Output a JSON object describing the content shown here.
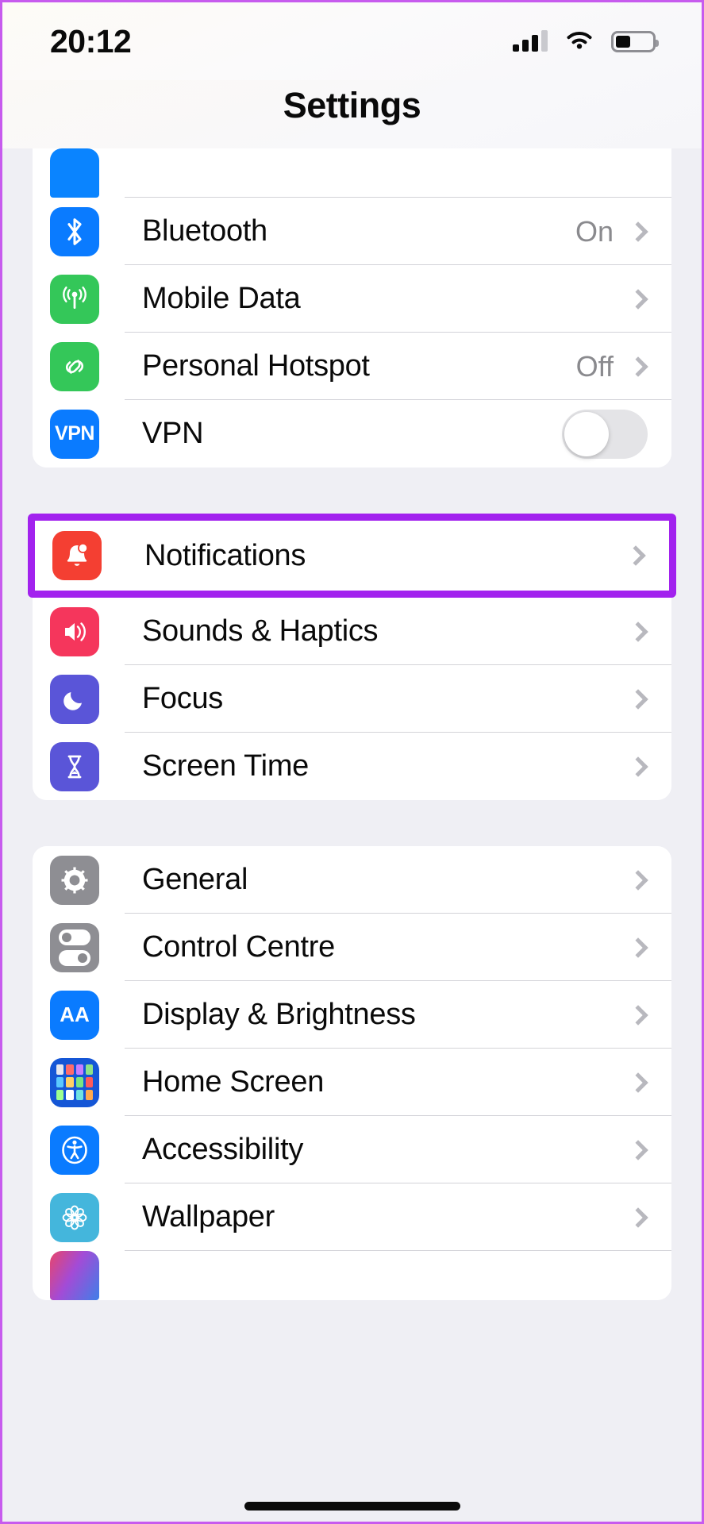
{
  "status_bar": {
    "time": "20:12",
    "signal_icon": "cellular-signal-icon",
    "wifi_icon": "wifi-icon",
    "battery_icon": "battery-icon",
    "battery_level_percent": 42
  },
  "nav": {
    "title": "Settings"
  },
  "highlight_color": "#A222EE",
  "frame_border_color": "#C75BEE",
  "groups": [
    {
      "name": "connectivity",
      "clipped_top": true,
      "rows": [
        {
          "label": "",
          "icon": "wifi-settings-icon",
          "icon_color": "#0A84FF",
          "value": "",
          "accessory": "none",
          "cut": true
        },
        {
          "label": "Bluetooth",
          "icon": "bluetooth-icon",
          "icon_color": "#0A7BFF",
          "value": "On",
          "accessory": "chevron"
        },
        {
          "label": "Mobile Data",
          "icon": "mobile-data-icon",
          "icon_color": "#34C759",
          "value": "",
          "accessory": "chevron"
        },
        {
          "label": "Personal Hotspot",
          "icon": "personal-hotspot-icon",
          "icon_color": "#34C759",
          "value": "Off",
          "accessory": "chevron"
        },
        {
          "label": "VPN",
          "icon": "vpn-icon",
          "icon_color": "#0A7BFF",
          "icon_text": "VPN",
          "value": "",
          "accessory": "toggle",
          "toggle_on": false
        }
      ]
    },
    {
      "name": "notifications-and-sound",
      "rows": [
        {
          "label": "Notifications",
          "icon": "notifications-bell-icon",
          "icon_color": "#F43F32",
          "value": "",
          "accessory": "chevron",
          "highlighted": true
        },
        {
          "label": "Sounds & Haptics",
          "icon": "sounds-haptics-icon",
          "icon_color": "#F5365C",
          "value": "",
          "accessory": "chevron"
        },
        {
          "label": "Focus",
          "icon": "focus-moon-icon",
          "icon_color": "#5A55D8",
          "value": "",
          "accessory": "chevron"
        },
        {
          "label": "Screen Time",
          "icon": "screen-time-hourglass-icon",
          "icon_color": "#5A55D8",
          "value": "",
          "accessory": "chevron"
        }
      ]
    },
    {
      "name": "system",
      "rows": [
        {
          "label": "General",
          "icon": "general-gear-icon",
          "icon_color": "#8E8E93",
          "value": "",
          "accessory": "chevron"
        },
        {
          "label": "Control Centre",
          "icon": "control-centre-icon",
          "icon_color": "#8E8E93",
          "value": "",
          "accessory": "chevron"
        },
        {
          "label": "Display & Brightness",
          "icon": "display-brightness-icon",
          "icon_color": "#0A7BFF",
          "icon_text": "AA",
          "value": "",
          "accessory": "chevron"
        },
        {
          "label": "Home Screen",
          "icon": "home-screen-icon",
          "icon_color": "#1556D6",
          "value": "",
          "accessory": "chevron"
        },
        {
          "label": "Accessibility",
          "icon": "accessibility-icon",
          "icon_color": "#0A7BFF",
          "value": "",
          "accessory": "chevron"
        },
        {
          "label": "Wallpaper",
          "icon": "wallpaper-flower-icon",
          "icon_color": "#44B6DC",
          "value": "",
          "accessory": "chevron"
        },
        {
          "label": "",
          "icon": "siri-icon",
          "icon_color": "#8E4AA8",
          "value": "",
          "accessory": "none",
          "cut": true
        }
      ]
    }
  ]
}
